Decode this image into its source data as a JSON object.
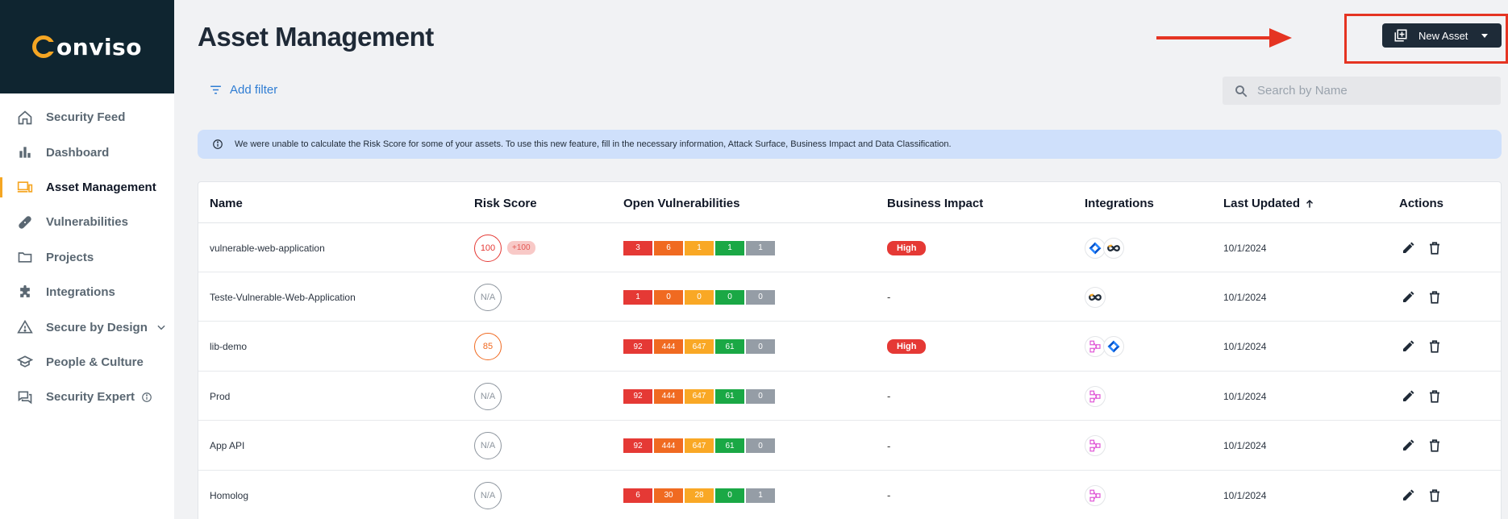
{
  "brand": {
    "name": "onviso",
    "accent": "#f5a623",
    "dark": "#0f2530"
  },
  "sidebar": {
    "items": [
      {
        "label": "Security Feed",
        "icon": "home-icon"
      },
      {
        "label": "Dashboard",
        "icon": "bar-chart-icon"
      },
      {
        "label": "Asset Management",
        "icon": "devices-icon",
        "active": true
      },
      {
        "label": "Vulnerabilities",
        "icon": "bandage-icon"
      },
      {
        "label": "Projects",
        "icon": "folder-icon"
      },
      {
        "label": "Integrations",
        "icon": "puzzle-icon"
      },
      {
        "label": "Secure by Design",
        "icon": "warning-icon"
      },
      {
        "label": "People & Culture",
        "icon": "graduation-cap-icon"
      },
      {
        "label": "Security Expert",
        "icon": "forum-icon"
      }
    ]
  },
  "header": {
    "title": "Asset Management",
    "new_asset_label": "New Asset",
    "add_filter_label": "Add filter",
    "search_placeholder": "Search by Name"
  },
  "banner": {
    "text": "We were unable to calculate the Risk Score for some of your assets. To use this new feature, fill in the necessary information, Attack Surface, Business Impact and Data Classification."
  },
  "table": {
    "columns": [
      "Name",
      "Risk Score",
      "Open Vulnerabilities",
      "Business Impact",
      "Integrations",
      "Last Updated",
      "Actions"
    ],
    "rows": [
      {
        "name": "vulnerable-web-application",
        "score": "100",
        "score_style": "red",
        "score_delta": "+100",
        "vulns": [
          "3",
          "6",
          "1",
          "1",
          "1"
        ],
        "impact": "High",
        "integrations": [
          "jira-icon",
          "conviso-icon"
        ],
        "updated": "10/1/2024"
      },
      {
        "name": "Teste-Vulnerable-Web-Application",
        "score": "N/A",
        "score_style": "na",
        "score_delta": "",
        "vulns": [
          "1",
          "0",
          "0",
          "0",
          "0"
        ],
        "impact": "-",
        "integrations": [
          "conviso-icon"
        ],
        "updated": "10/1/2024"
      },
      {
        "name": "lib-demo",
        "score": "85",
        "score_style": "orange",
        "score_delta": "",
        "vulns": [
          "92",
          "444",
          "647",
          "61",
          "0"
        ],
        "impact": "High",
        "integrations": [
          "graph-icon",
          "jira-icon"
        ],
        "updated": "10/1/2024"
      },
      {
        "name": "Prod",
        "score": "N/A",
        "score_style": "na",
        "score_delta": "",
        "vulns": [
          "92",
          "444",
          "647",
          "61",
          "0"
        ],
        "impact": "-",
        "integrations": [
          "graph-icon"
        ],
        "updated": "10/1/2024"
      },
      {
        "name": "App API",
        "score": "N/A",
        "score_style": "na",
        "score_delta": "",
        "vulns": [
          "92",
          "444",
          "647",
          "61",
          "0"
        ],
        "impact": "-",
        "integrations": [
          "graph-icon"
        ],
        "updated": "10/1/2024"
      },
      {
        "name": "Homolog",
        "score": "N/A",
        "score_style": "na",
        "score_delta": "",
        "vulns": [
          "6",
          "30",
          "28",
          "0",
          "1"
        ],
        "impact": "-",
        "integrations": [
          "graph-icon"
        ],
        "updated": "10/1/2024"
      }
    ]
  }
}
